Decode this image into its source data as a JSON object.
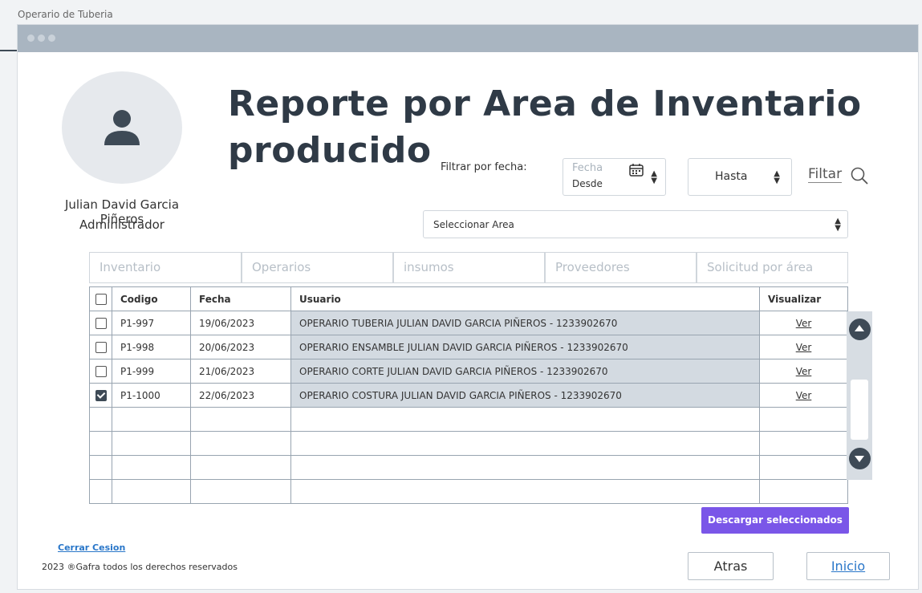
{
  "frame_label": "Operario de Tuberia",
  "user": {
    "name": "Julian David Garcia Piñeros",
    "role": "Administrador"
  },
  "title": "Reporte por Area de Inventario producido",
  "filter": {
    "label": "Filtrar por fecha:",
    "date_placeholder": "Fecha",
    "date_value": "Desde",
    "hasta_value": "Hasta",
    "filtar_label": "Filtar"
  },
  "area_select": {
    "value": "Seleccionar Area"
  },
  "tabs": [
    {
      "label": "Inventario"
    },
    {
      "label": "Operarios"
    },
    {
      "label": "insumos"
    },
    {
      "label": "Proveedores"
    },
    {
      "label": "Solicitud por área"
    }
  ],
  "table": {
    "headers": {
      "codigo": "Codigo",
      "fecha": "Fecha",
      "usuario": "Usuario",
      "visualizar": "Visualizar"
    },
    "rows": [
      {
        "checked": false,
        "codigo": "P1-997",
        "fecha": "19/06/2023",
        "usuario": "OPERARIO TUBERIA JULIAN DAVID GARCIA PIÑEROS - 1233902670",
        "ver": "Ver"
      },
      {
        "checked": false,
        "codigo": "P1-998",
        "fecha": "20/06/2023",
        "usuario": "OPERARIO ENSAMBLE JULIAN DAVID GARCIA PIÑEROS - 1233902670",
        "ver": "Ver"
      },
      {
        "checked": false,
        "codigo": "P1-999",
        "fecha": "21/06/2023",
        "usuario": "OPERARIO CORTE JULIAN DAVID GARCIA PIÑEROS - 1233902670",
        "ver": "Ver"
      },
      {
        "checked": true,
        "codigo": "P1-1000",
        "fecha": "22/06/2023",
        "usuario": "OPERARIO COSTURA JULIAN DAVID GARCIA PIÑEROS - 1233902670",
        "ver": "Ver"
      }
    ],
    "empty_rows": 4
  },
  "download_label": "Descargar seleccionados",
  "footer": {
    "logout": "Cerrar Cesion",
    "copyright": "2023 ®Gafra todos los derechos reservados"
  },
  "buttons": {
    "back": "Atras",
    "home": "Inicio"
  },
  "colors": {
    "accent": "#7a56e8",
    "link": "#2a77c9",
    "titlebar": "#a9b5c1",
    "title_text": "#2f3a46"
  }
}
